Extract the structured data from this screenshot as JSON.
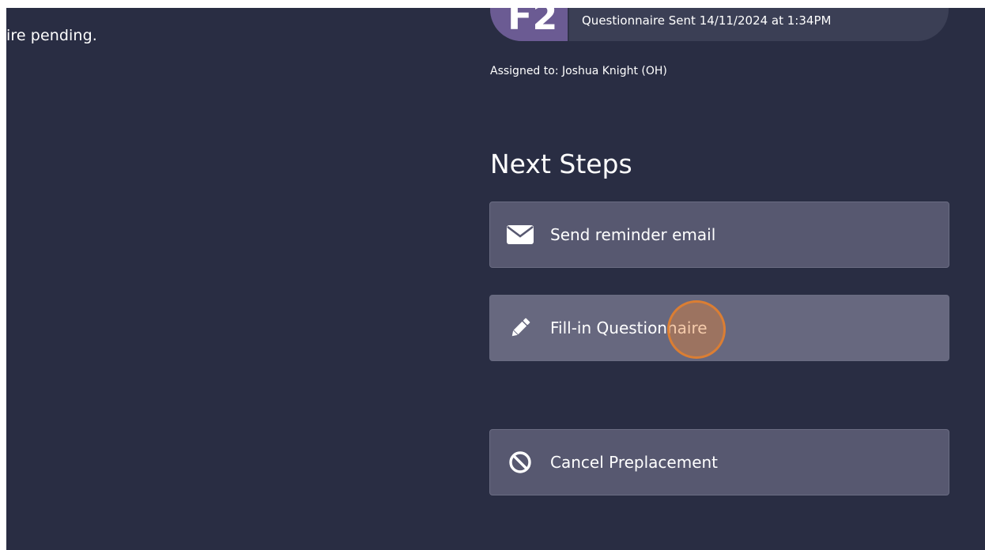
{
  "page": {
    "pending_text": "ire pending.",
    "status": {
      "badge_text": "F2",
      "questionnaire_sent": "Questionnaire Sent 14/11/2024 at 1:34PM"
    },
    "assigned_to": "Assigned to: Joshua Knight (OH)",
    "next_steps": {
      "heading": "Next Steps",
      "actions": [
        {
          "label": "Send reminder email",
          "icon": "envelope-icon"
        },
        {
          "label": "Fill-in Questionnaire",
          "icon": "pencil-icon"
        },
        {
          "label": "Cancel Preplacement",
          "icon": "ban-icon"
        }
      ]
    }
  },
  "colors": {
    "background": "#292d43",
    "button": "#575870",
    "button_hover": "#67687f",
    "badge": "#6b5b93",
    "click_highlight": "#e88438"
  }
}
